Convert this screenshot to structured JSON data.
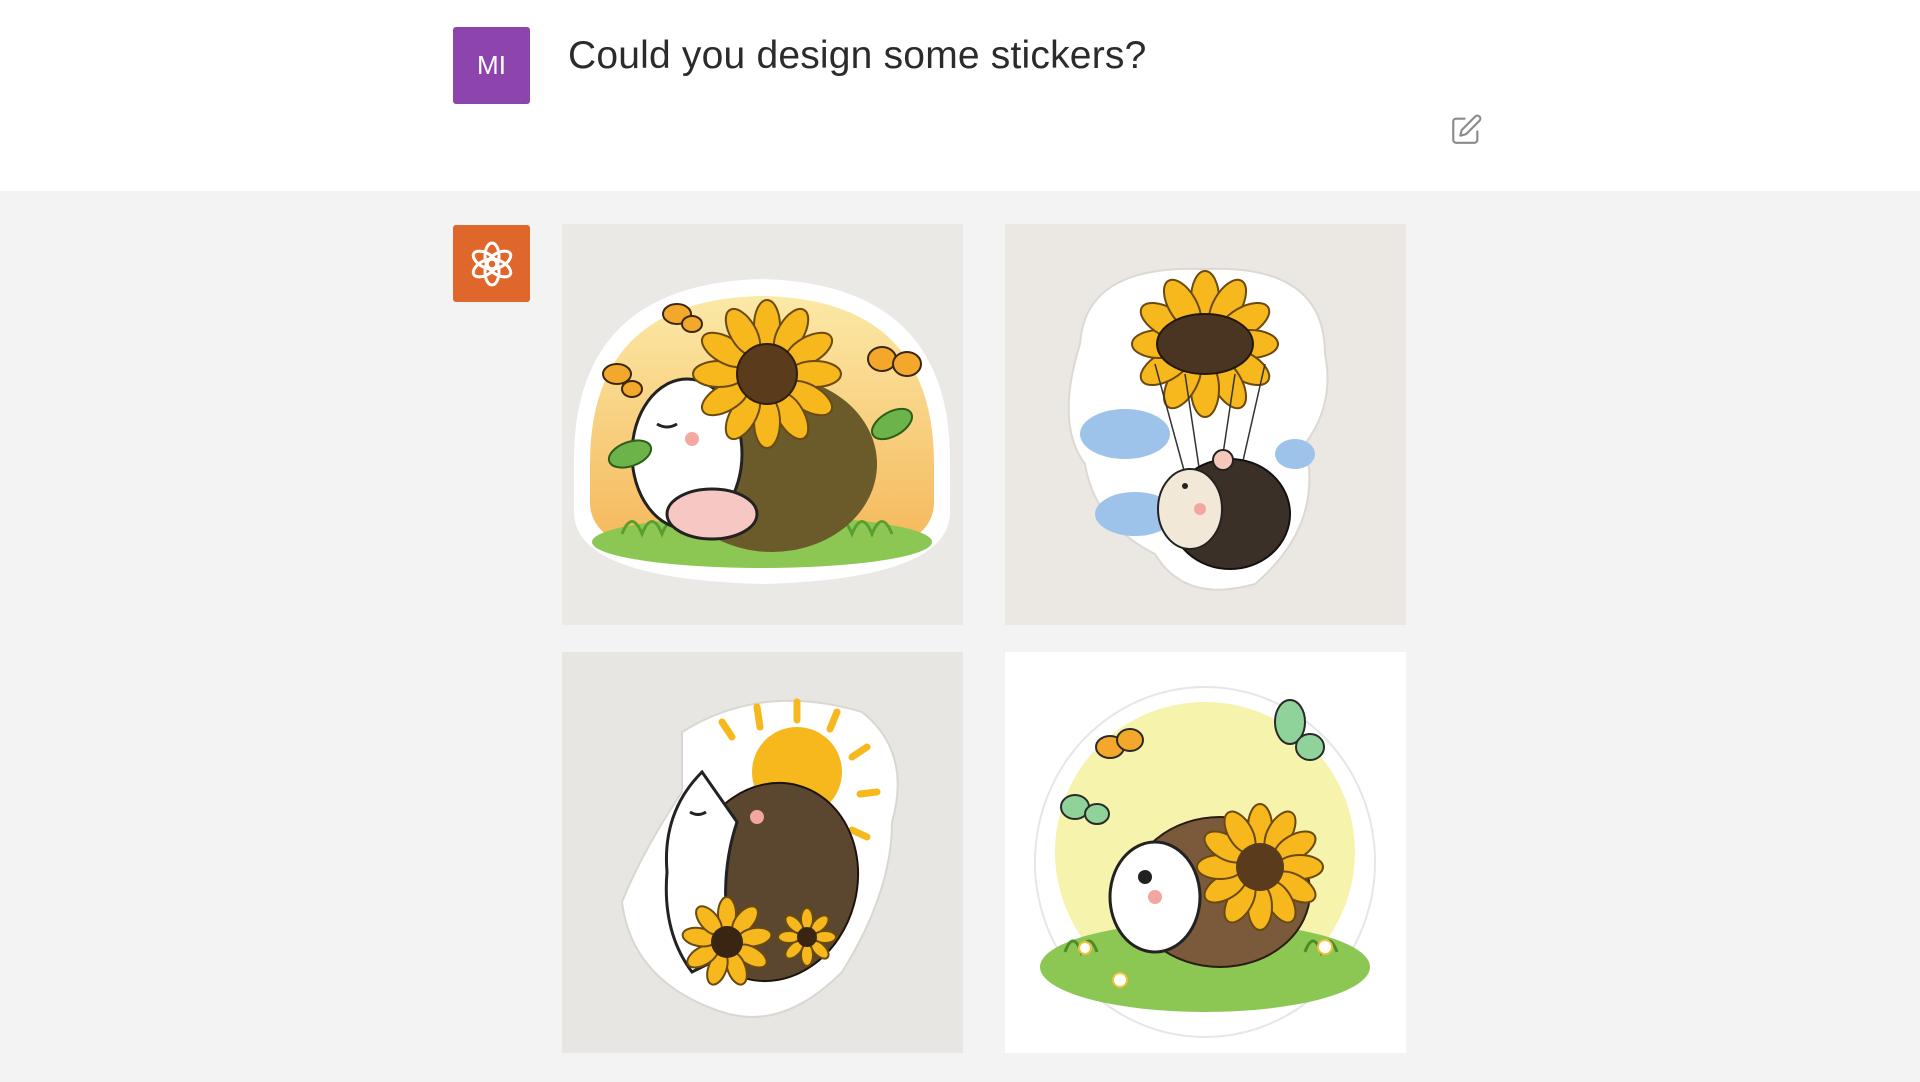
{
  "conversation": {
    "user": {
      "initials": "MI",
      "message": "Could you design some stickers?",
      "avatar_color": "#8e44ad"
    },
    "assistant": {
      "avatar_icon": "openai-logo-icon",
      "avatar_color": "#e0672b",
      "images": [
        {
          "name": "hedgehog-holding-sunflower-sticker",
          "background": "#ebe9e6"
        },
        {
          "name": "hedgehog-sunflower-parachute-sticker",
          "background": "#ebe8e3"
        },
        {
          "name": "hedgehog-sunbathing-sticker",
          "background": "#e8e6e2"
        },
        {
          "name": "hedgehog-meadow-butterflies-sticker",
          "background": "#ffffff"
        }
      ]
    }
  },
  "icons": {
    "edit": "edit-icon"
  }
}
